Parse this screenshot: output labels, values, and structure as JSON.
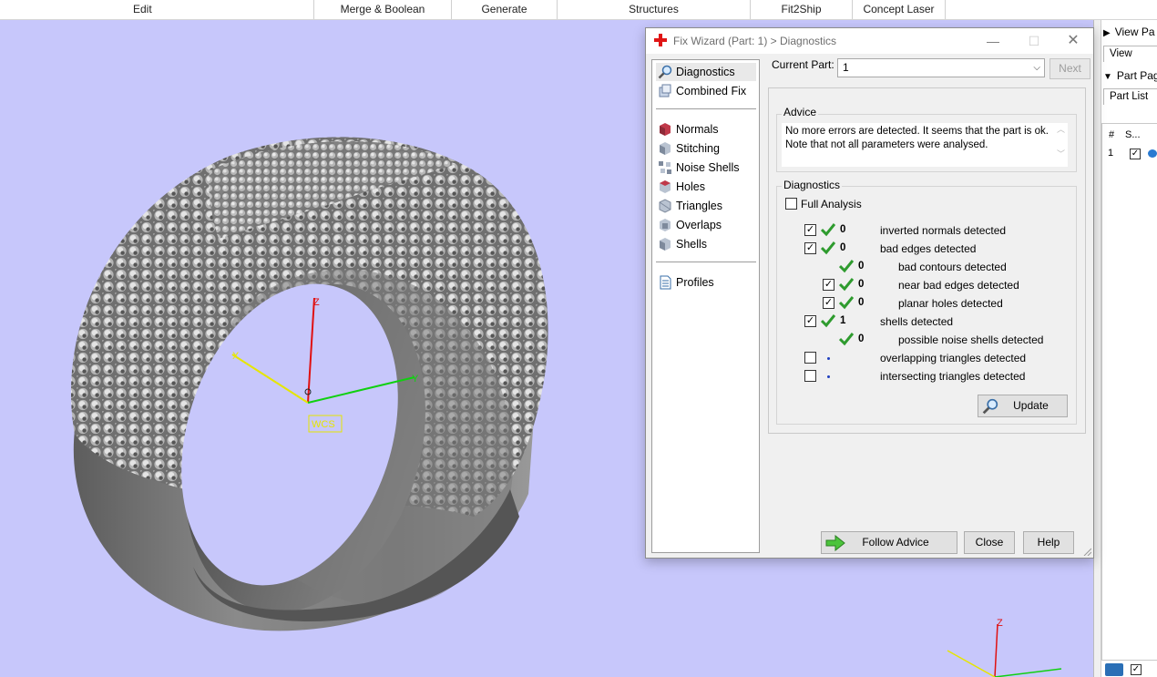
{
  "ribbon": {
    "tabs": [
      "Edit",
      "Merge & Boolean",
      "Generate",
      "Structures",
      "Fit2Ship",
      "Concept Laser"
    ]
  },
  "viewport": {
    "axis_label": "WCS",
    "axis_x": "X",
    "axis_y": "Y",
    "axis_z": "Z",
    "corner_axis_z": "Z",
    "background_color": "#c7c7fb"
  },
  "right_panel": {
    "view_pages_label": "View Pa",
    "view_tab": "View",
    "part_pages_label": "Part Pag",
    "part_list_tab": "Part List",
    "columns": [
      "#",
      "S..."
    ],
    "row": {
      "index": "1"
    }
  },
  "dialog": {
    "title": "Fix Wizard (Part: 1) > Diagnostics",
    "nav": {
      "group1": [
        "Diagnostics",
        "Combined Fix"
      ],
      "group2": [
        "Normals",
        "Stitching",
        "Noise Shells",
        "Holes",
        "Triangles",
        "Overlaps",
        "Shells"
      ],
      "group3": [
        "Profiles"
      ]
    },
    "current_part_label": "Current Part:",
    "current_part_value": "1",
    "next_label": "Next",
    "advice": {
      "label": "Advice",
      "text_line1": "No more errors are detected. It seems that the part is ok.",
      "text_line2": "Note that not all parameters were analysed."
    },
    "diagnostics": {
      "label": "Diagnostics",
      "full_analysis": "Full Analysis",
      "rows": [
        {
          "count": "0",
          "text": "inverted normals detected"
        },
        {
          "count": "0",
          "text": "bad edges detected"
        },
        {
          "count": "0",
          "text": "bad contours detected"
        },
        {
          "count": "0",
          "text": "near bad edges detected"
        },
        {
          "count": "0",
          "text": "planar holes detected"
        },
        {
          "count": "1",
          "text": "shells detected"
        },
        {
          "count": "0",
          "text": "possible noise shells detected"
        },
        {
          "count": "",
          "text": "overlapping triangles detected"
        },
        {
          "count": "",
          "text": "intersecting triangles detected"
        }
      ],
      "update_label": "Update"
    },
    "buttons": {
      "follow_advice": "Follow Advice",
      "close": "Close",
      "help": "Help"
    },
    "accent_green": "#2e9b2e"
  }
}
